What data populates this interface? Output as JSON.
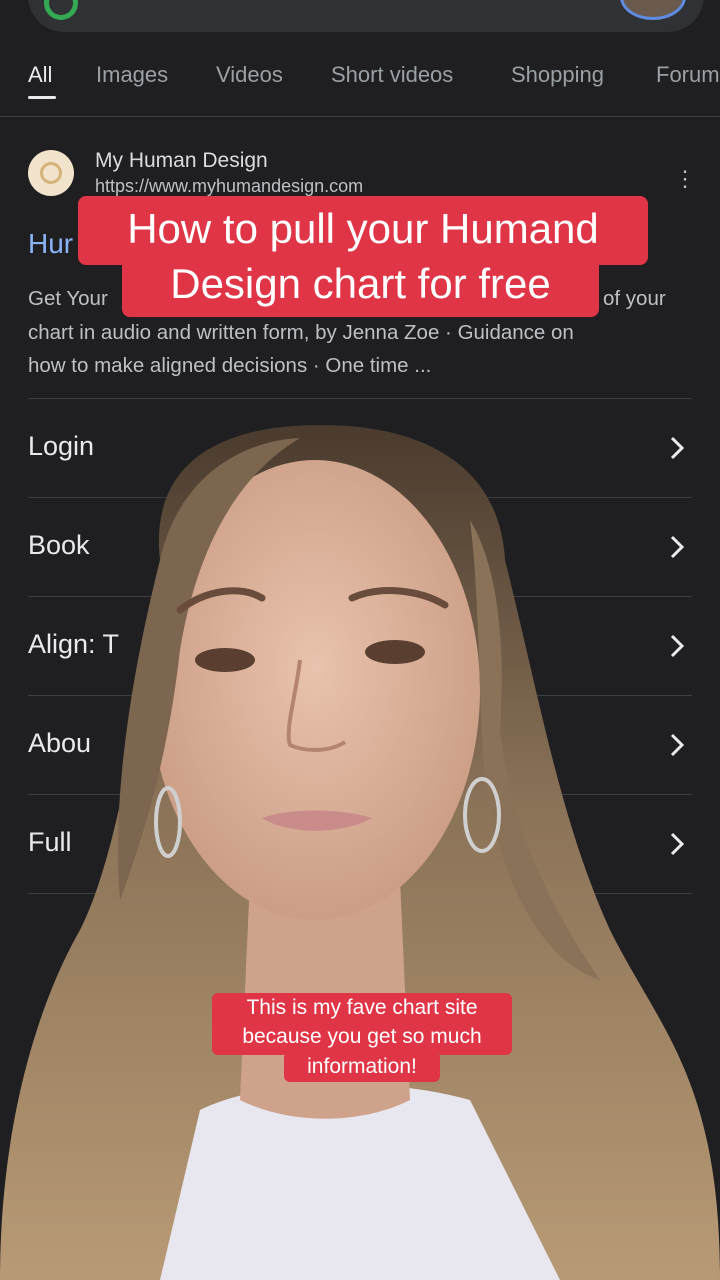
{
  "search_tabs": [
    "All",
    "Images",
    "Videos",
    "Short videos",
    "Shopping",
    "Forum"
  ],
  "result": {
    "site_name": "My Human Design",
    "site_url": "https://www.myhumandesign.com",
    "title_visible": "Hur",
    "snippet_lines": [
      "Get Your",
      "of your",
      "chart in audio and written form, by Jenna Zoe · Guidance on",
      "how to make aligned decisions · One time ..."
    ],
    "more_icon": "kebab-menu-icon"
  },
  "sitelinks": [
    {
      "label": "Login",
      "icon": "chevron-right-icon"
    },
    {
      "label": "Book",
      "icon": "chevron-right-icon"
    },
    {
      "label": "Align: T",
      "icon": "chevron-right-icon"
    },
    {
      "label": "Abou",
      "icon": "chevron-right-icon"
    },
    {
      "label": "Full",
      "icon": "chevron-right-icon"
    }
  ],
  "captions": {
    "headline_line1": "How to pull your Humand",
    "headline_line2": "Design chart for free",
    "subtitle_line1": "This is my fave chart site",
    "subtitle_line2": "because you get so much",
    "subtitle_line3": "information!"
  },
  "colors": {
    "background": "#1f1f21",
    "caption_red": "#e03546",
    "link_blue": "#8ab4f8",
    "text_light": "#e8eaed",
    "text_muted": "#bdc1c6"
  }
}
